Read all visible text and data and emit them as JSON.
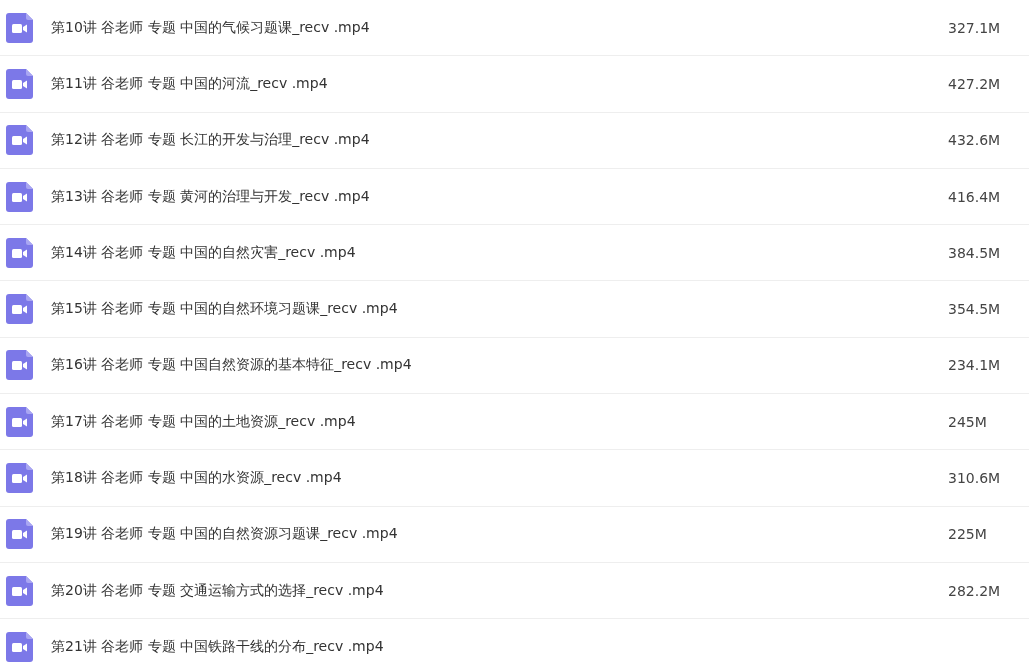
{
  "files": [
    {
      "name": "第10讲 谷老师 专题 中国的气候习题课_recv .mp4",
      "size": "327.1M"
    },
    {
      "name": "第11讲 谷老师 专题 中国的河流_recv .mp4",
      "size": "427.2M"
    },
    {
      "name": "第12讲 谷老师 专题 长江的开发与治理_recv .mp4",
      "size": "432.6M"
    },
    {
      "name": "第13讲 谷老师 专题 黄河的治理与开发_recv .mp4",
      "size": "416.4M"
    },
    {
      "name": "第14讲 谷老师 专题 中国的自然灾害_recv .mp4",
      "size": "384.5M"
    },
    {
      "name": "第15讲 谷老师 专题 中国的自然环境习题课_recv .mp4",
      "size": "354.5M"
    },
    {
      "name": "第16讲 谷老师 专题 中国自然资源的基本特征_recv .mp4",
      "size": "234.1M"
    },
    {
      "name": "第17讲 谷老师 专题 中国的土地资源_recv .mp4",
      "size": "245M"
    },
    {
      "name": "第18讲 谷老师 专题 中国的水资源_recv .mp4",
      "size": "310.6M"
    },
    {
      "name": "第19讲 谷老师 专题 中国的自然资源习题课_recv .mp4",
      "size": "225M"
    },
    {
      "name": "第20讲 谷老师 专题 交通运输方式的选择_recv .mp4",
      "size": "282.2M"
    },
    {
      "name": "第21讲 谷老师 专题 中国铁路干线的分布_recv .mp4"
    }
  ]
}
